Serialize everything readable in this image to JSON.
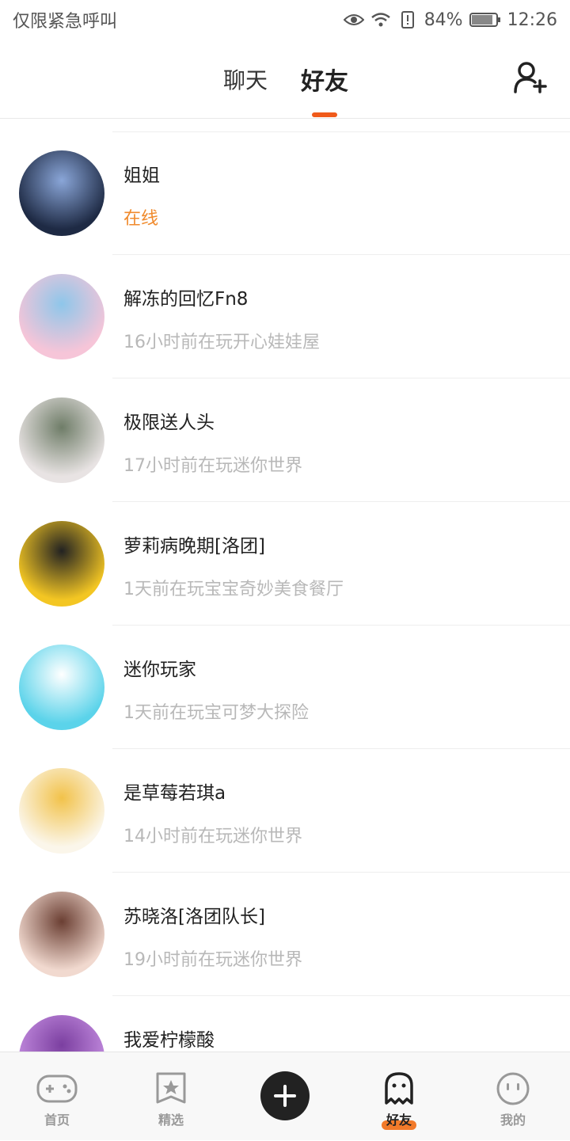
{
  "status_bar": {
    "carrier": "仅限紧急呼叫",
    "battery": "84%",
    "time": "12:26"
  },
  "header": {
    "tabs": [
      {
        "label": "聊天",
        "active": false
      },
      {
        "label": "好友",
        "active": true
      }
    ],
    "accent_color": "#f05a1a"
  },
  "friends": [
    {
      "name": "姐姐",
      "status": "在线",
      "online": true,
      "avatar_colors": [
        "#1e2a44",
        "#8aa6d8"
      ]
    },
    {
      "name": "解冻的回忆Fn8",
      "status": "16小时前在玩开心娃娃屋",
      "online": false,
      "avatar_colors": [
        "#f6c5d8",
        "#8ec6ea"
      ]
    },
    {
      "name": "极限送人头",
      "status": "17小时前在玩迷你世界",
      "online": false,
      "avatar_colors": [
        "#e8e3e3",
        "#6f7d68"
      ]
    },
    {
      "name": "萝莉病晚期[洛团]",
      "status": "1天前在玩宝宝奇妙美食餐厅",
      "online": false,
      "avatar_colors": [
        "#f3c623",
        "#222222"
      ]
    },
    {
      "name": "迷你玩家",
      "status": "1天前在玩宝可梦大探险",
      "online": false,
      "avatar_colors": [
        "#5bd3ea",
        "#ffffff"
      ]
    },
    {
      "name": "是草莓若琪a",
      "status": "14小时前在玩迷你世界",
      "online": false,
      "avatar_colors": [
        "#fbf6ea",
        "#f2c24a"
      ]
    },
    {
      "name": "苏晓洛[洛团队长]",
      "status": "19小时前在玩迷你世界",
      "online": false,
      "avatar_colors": [
        "#f1d9cf",
        "#6b3f33"
      ]
    },
    {
      "name": "我爱柠檬酸",
      "status": "",
      "online": false,
      "avatar_colors": [
        "#c48de0",
        "#7b3fa0"
      ]
    }
  ],
  "bottom_nav": [
    {
      "label": "首页",
      "icon": "gamepad-icon",
      "active": false
    },
    {
      "label": "精选",
      "icon": "star-icon",
      "active": false
    },
    {
      "label": "",
      "icon": "plus-icon",
      "active": false
    },
    {
      "label": "好友",
      "icon": "ghost-icon",
      "active": true
    },
    {
      "label": "我的",
      "icon": "face-icon",
      "active": false
    }
  ]
}
